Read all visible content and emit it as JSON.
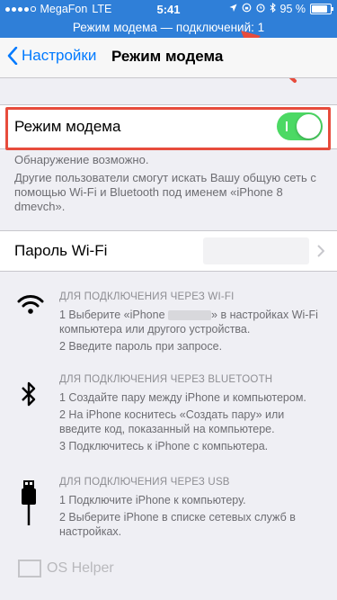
{
  "status_bar": {
    "carrier": "MegaFon",
    "network": "LTE",
    "time": "5:41",
    "battery": "95 %",
    "battery_level": 0.95
  },
  "hotspot_banner": "Режим модема — подключений: 1",
  "nav": {
    "back_label": "Настройки",
    "title": "Режим модема"
  },
  "toggle": {
    "label": "Режим модема",
    "state": "on"
  },
  "footer": {
    "line1": "Обнаружение возможно.",
    "line2": "Другие пользователи смогут искать Вашу общую сеть с помощью Wi-Fi и Bluetooth под именем «iPhone 8 dmevch»."
  },
  "wifi_password": {
    "label": "Пароль Wi-Fi"
  },
  "sections": {
    "wifi": {
      "heading": "ДЛЯ ПОДКЛЮЧЕНИЯ ЧЕРЕЗ WI-FI",
      "step1_a": "1 Выберите «iPhone",
      "step1_b": "» в настройках Wi-Fi компьютера или другого устройства.",
      "step2": "2 Введите пароль при запросе."
    },
    "bluetooth": {
      "heading": "ДЛЯ ПОДКЛЮЧЕНИЯ ЧЕРЕЗ BLUETOOTH",
      "step1": "1 Создайте пару между iPhone и компьютером.",
      "step2": "2 На iPhone коснитесь «Создать пару» или введите код, показанный на компьютере.",
      "step3": "3 Подключитесь к iPhone с компьютера."
    },
    "usb": {
      "heading": "ДЛЯ ПОДКЛЮЧЕНИЯ ЧЕРЕЗ USB",
      "step1": "1 Подключите iPhone к компьютеру.",
      "step2": "2 Выберите iPhone в списке сетевых служб в настройках."
    }
  },
  "watermark": "OS Helper",
  "colors": {
    "accent": "#007aff",
    "status_bar": "#2f7fd8",
    "switch_on": "#4cd964",
    "annotation": "#e74c3c"
  }
}
